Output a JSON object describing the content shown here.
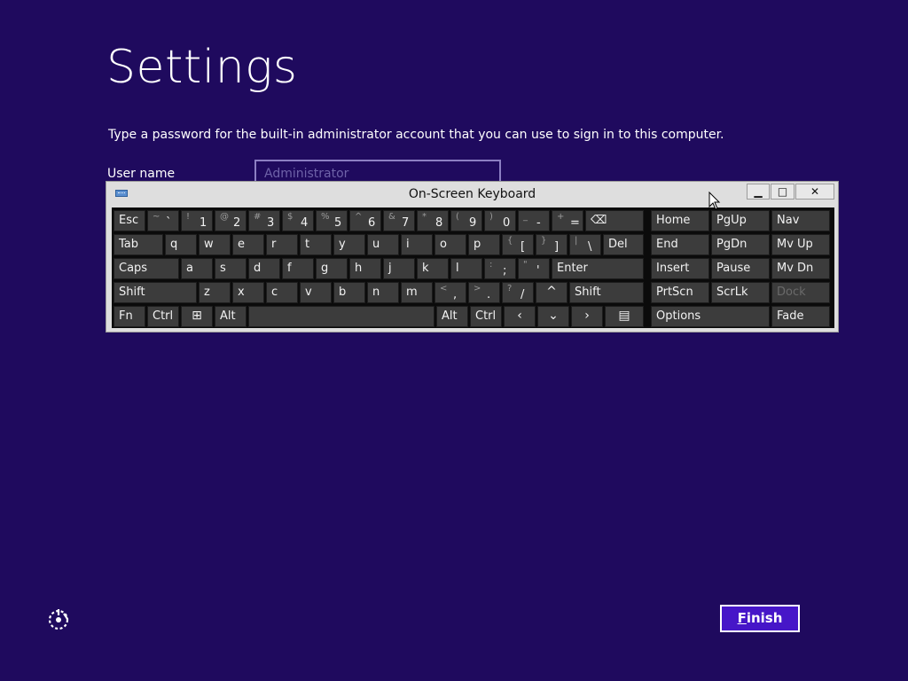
{
  "page": {
    "title": "Settings",
    "description": "Type a password for the built-in administrator account that you can use to sign in to this computer.",
    "username_label": "User name",
    "username_value": "Administrator",
    "finish_label": "Finish",
    "finish_accesskey": "F"
  },
  "osk": {
    "title": "On-Screen Keyboard",
    "controls": {
      "minimize": "▁",
      "maximize": "□",
      "close": "✕"
    },
    "keys": [
      {
        "name": "esc",
        "label": "Esc"
      },
      {
        "name": "backtick",
        "shift": "~",
        "main": "`"
      },
      {
        "name": "1",
        "shift": "!",
        "main": "1"
      },
      {
        "name": "2",
        "shift": "@",
        "main": "2"
      },
      {
        "name": "3",
        "shift": "#",
        "main": "3"
      },
      {
        "name": "4",
        "shift": "$",
        "main": "4"
      },
      {
        "name": "5",
        "shift": "%",
        "main": "5"
      },
      {
        "name": "6",
        "shift": "^",
        "main": "6"
      },
      {
        "name": "7",
        "shift": "&",
        "main": "7"
      },
      {
        "name": "8",
        "shift": "*",
        "main": "8"
      },
      {
        "name": "9",
        "shift": "(",
        "main": "9"
      },
      {
        "name": "0",
        "shift": ")",
        "main": "0"
      },
      {
        "name": "minus",
        "shift": "_",
        "main": "-"
      },
      {
        "name": "equals",
        "shift": "+",
        "main": "="
      },
      {
        "name": "backspace",
        "label": "⌫"
      },
      {
        "name": "home",
        "label": "Home"
      },
      {
        "name": "pgup",
        "label": "PgUp"
      },
      {
        "name": "nav",
        "label": "Nav"
      },
      {
        "name": "tab",
        "label": "Tab"
      },
      {
        "name": "q",
        "label": "q"
      },
      {
        "name": "w",
        "label": "w"
      },
      {
        "name": "e",
        "label": "e"
      },
      {
        "name": "r",
        "label": "r"
      },
      {
        "name": "t",
        "label": "t"
      },
      {
        "name": "y",
        "label": "y"
      },
      {
        "name": "u",
        "label": "u"
      },
      {
        "name": "i",
        "label": "i"
      },
      {
        "name": "o",
        "label": "o"
      },
      {
        "name": "p",
        "label": "p"
      },
      {
        "name": "lbracket",
        "shift": "{",
        "main": "["
      },
      {
        "name": "rbracket",
        "shift": "}",
        "main": "]"
      },
      {
        "name": "backslash",
        "shift": "|",
        "main": "\\"
      },
      {
        "name": "del",
        "label": "Del"
      },
      {
        "name": "end",
        "label": "End"
      },
      {
        "name": "pgdn",
        "label": "PgDn"
      },
      {
        "name": "mvup",
        "label": "Mv Up"
      },
      {
        "name": "caps",
        "label": "Caps"
      },
      {
        "name": "a",
        "label": "a"
      },
      {
        "name": "s",
        "label": "s"
      },
      {
        "name": "d",
        "label": "d"
      },
      {
        "name": "f",
        "label": "f"
      },
      {
        "name": "g",
        "label": "g"
      },
      {
        "name": "h",
        "label": "h"
      },
      {
        "name": "j",
        "label": "j"
      },
      {
        "name": "k",
        "label": "k"
      },
      {
        "name": "l",
        "label": "l"
      },
      {
        "name": "semicolon",
        "shift": ":",
        "main": ";"
      },
      {
        "name": "quote",
        "shift": "\"",
        "main": "'"
      },
      {
        "name": "enter",
        "label": "Enter"
      },
      {
        "name": "insert",
        "label": "Insert"
      },
      {
        "name": "pause",
        "label": "Pause"
      },
      {
        "name": "mvdn",
        "label": "Mv Dn"
      },
      {
        "name": "lshift",
        "label": "Shift"
      },
      {
        "name": "z",
        "label": "z"
      },
      {
        "name": "x",
        "label": "x"
      },
      {
        "name": "c",
        "label": "c"
      },
      {
        "name": "v",
        "label": "v"
      },
      {
        "name": "b",
        "label": "b"
      },
      {
        "name": "n",
        "label": "n"
      },
      {
        "name": "m",
        "label": "m"
      },
      {
        "name": "comma",
        "shift": "<",
        "main": ","
      },
      {
        "name": "period",
        "shift": ">",
        "main": "."
      },
      {
        "name": "slash",
        "shift": "?",
        "main": "/"
      },
      {
        "name": "uparrow",
        "glyph": "^"
      },
      {
        "name": "rshift",
        "label": "Shift"
      },
      {
        "name": "prtscn",
        "label": "PrtScn"
      },
      {
        "name": "scrlk",
        "label": "ScrLk"
      },
      {
        "name": "dock",
        "label": "Dock"
      },
      {
        "name": "fn",
        "label": "Fn"
      },
      {
        "name": "lctrl",
        "label": "Ctrl"
      },
      {
        "name": "win",
        "glyph": "⊞"
      },
      {
        "name": "lalt",
        "label": "Alt"
      },
      {
        "name": "space",
        "label": ""
      },
      {
        "name": "ralt",
        "label": "Alt"
      },
      {
        "name": "rctrl",
        "label": "Ctrl"
      },
      {
        "name": "leftarrow",
        "glyph": "‹"
      },
      {
        "name": "downarrow",
        "glyph": "⌄"
      },
      {
        "name": "rightarrow",
        "glyph": "›"
      },
      {
        "name": "menu",
        "glyph": "▤"
      },
      {
        "name": "options",
        "label": "Options"
      },
      {
        "name": "fade",
        "label": "Fade"
      }
    ]
  },
  "colors": {
    "background": "#1f0a5e",
    "finish_button": "#4616c8",
    "key": "#3c3c3c"
  }
}
